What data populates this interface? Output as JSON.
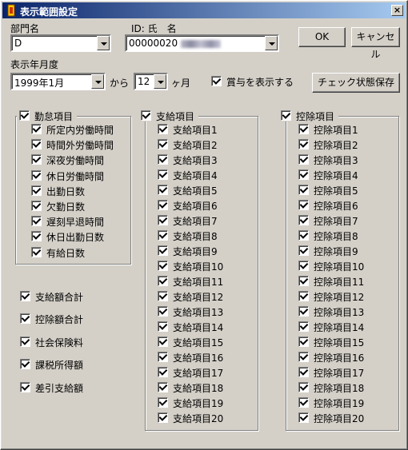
{
  "window": {
    "title": "表示範囲設定",
    "close_label": "×"
  },
  "dept": {
    "label": "部門名",
    "value": "D"
  },
  "employee": {
    "label": "ID: 氏　名",
    "value": "00000020"
  },
  "period": {
    "label": "表示年月度",
    "value": "1999年1月",
    "from_label": "から",
    "months_value": "12",
    "months_unit": "ヶ月"
  },
  "bonus": {
    "label": "賞与を表示する",
    "checked": true
  },
  "buttons": {
    "ok": "OK",
    "cancel": "キャンセル",
    "save": "チェック状態保存"
  },
  "attendance": {
    "title": "勤怠項目",
    "items": [
      "所定内労働時間",
      "時間外労働時間",
      "深夜労働時間",
      "休日労働時間",
      "出勤日数",
      "欠勤日数",
      "遅刻早退時間",
      "休日出勤日数",
      "有給日数"
    ]
  },
  "totals": [
    "支給額合計",
    "控除額合計",
    "社会保険料",
    "課税所得額",
    "差引支給額"
  ],
  "payment": {
    "title": "支給項目",
    "items": [
      "支給項目1",
      "支給項目2",
      "支給項目3",
      "支給項目4",
      "支給項目5",
      "支給項目6",
      "支給項目7",
      "支給項目8",
      "支給項目9",
      "支給項目10",
      "支給項目11",
      "支給項目12",
      "支給項目13",
      "支給項目14",
      "支給項目15",
      "支給項目16",
      "支給項目17",
      "支給項目18",
      "支給項目19",
      "支給項目20"
    ]
  },
  "deduction": {
    "title": "控除項目",
    "items": [
      "控除項目1",
      "控除項目2",
      "控除項目3",
      "控除項目4",
      "控除項目5",
      "控除項目6",
      "控除項目7",
      "控除項目8",
      "控除項目9",
      "控除項目10",
      "控除項目11",
      "控除項目12",
      "控除項目13",
      "控除項目14",
      "控除項目15",
      "控除項目16",
      "控除項目17",
      "控除項目18",
      "控除項目19",
      "控除項目20"
    ]
  }
}
